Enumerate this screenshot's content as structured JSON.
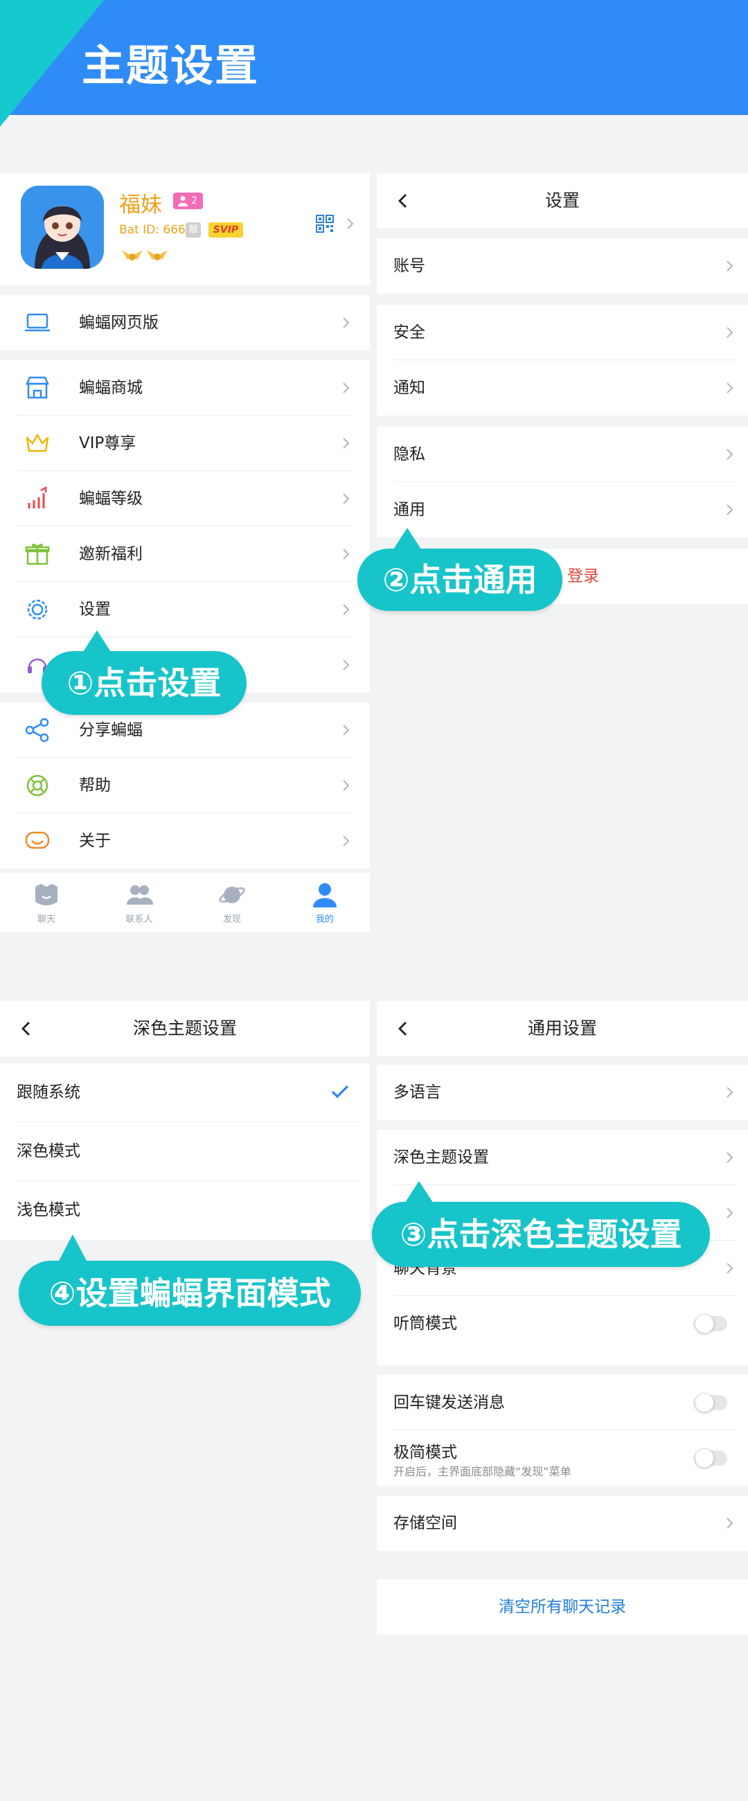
{
  "banner": {
    "title": "主题设置"
  },
  "profile": {
    "name": "福妹",
    "friend_badge": "2",
    "bat_id": "Bat ID: 666",
    "badge_tag": "靓",
    "vip_tag": "SVIP"
  },
  "menu": {
    "web": "蝙蝠网页版",
    "mall": "蝙蝠商城",
    "vip": "VIP尊享",
    "level": "蝙蝠等级",
    "invite": "邀新福利",
    "settings": "设置",
    "share": "分享蝙蝠",
    "help": "帮助",
    "about": "关于"
  },
  "tabbar": [
    {
      "label": "聊天"
    },
    {
      "label": "联系人"
    },
    {
      "label": "发现"
    },
    {
      "label": "我的"
    }
  ],
  "settings": {
    "title": "设置",
    "account": "账号",
    "security": "安全",
    "notify": "通知",
    "privacy": "隐私",
    "general": "通用",
    "logout": "登录"
  },
  "dark_theme": {
    "title": "深色主题设置",
    "follow": "跟随系统",
    "dark": "深色模式",
    "light": "浅色模式"
  },
  "general": {
    "title": "通用设置",
    "language": "多语言",
    "dark_theme": "深色主题设置",
    "chat_bg": "聊天背景",
    "earpiece": "听筒模式",
    "enter_send": "回车键发送消息",
    "minimal": "极简模式",
    "minimal_sub": "开启后，主界面底部隐藏“发现”菜单",
    "storage": "存储空间",
    "clear": "清空所有聊天记录"
  },
  "callouts": {
    "c1": "①点击设置",
    "c2": "②点击通用",
    "c3": "③点击深色主题设置",
    "c4": "④设置蝙蝠界面模式"
  },
  "colors": {
    "banner": "#2f8cf6",
    "accent_teal": "#17c4c9",
    "name_orange": "#f0a21a",
    "link_blue": "#1f7fd8",
    "danger_red": "#e0463c",
    "check_blue": "#2f86e8"
  }
}
